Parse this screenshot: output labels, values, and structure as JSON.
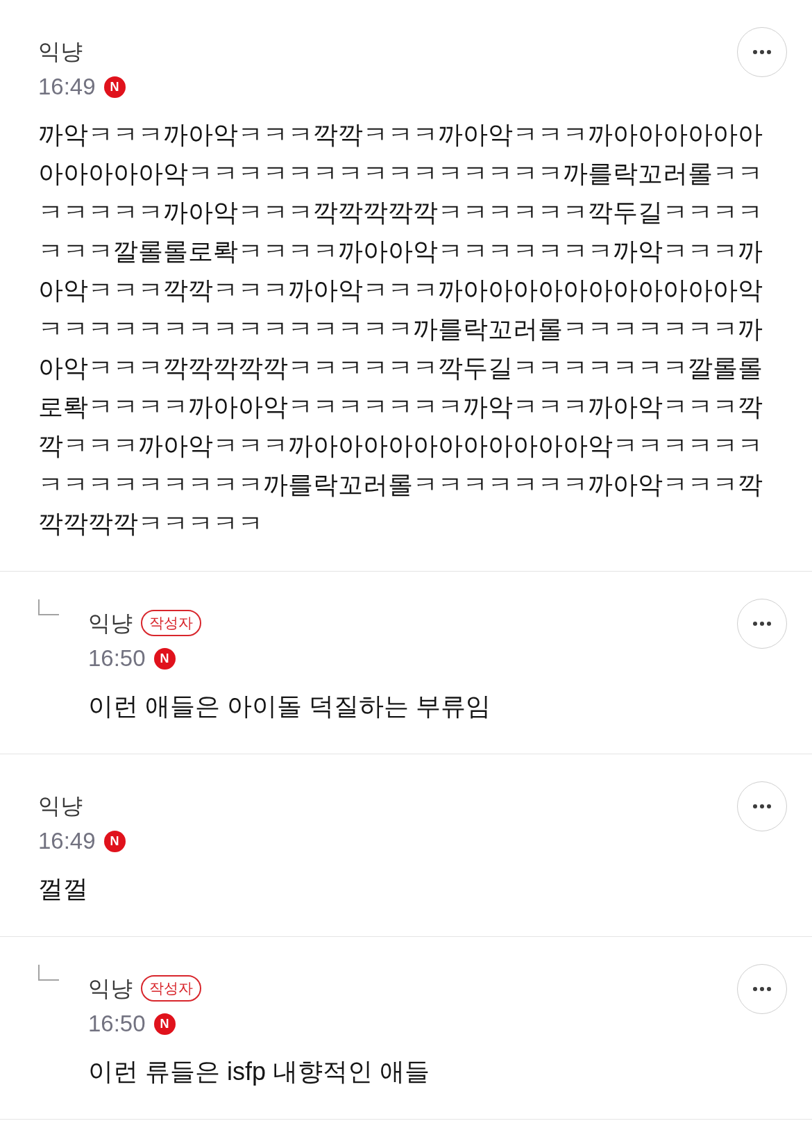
{
  "comments": [
    {
      "kind": "comment",
      "author": "익냥",
      "time": "16:49",
      "new_badge": "N",
      "body": "까악ㅋㅋㅋ까아악ㅋㅋㅋ깍깍ㅋㅋㅋ까아악ㅋㅋㅋ까아아아아아아아아아아아악ㅋㅋㅋㅋㅋㅋㅋㅋㅋㅋㅋㅋㅋㅋㅋ까를락꼬러롤ㅋㅋㅋㅋㅋㅋㅋ까아악ㅋㅋㅋ깍깍깍깍깍ㅋㅋㅋㅋㅋㅋ깍두길ㅋㅋㅋㅋㅋㅋㅋ깔롤롤로롹ㅋㅋㅋㅋ까아아악ㅋㅋㅋㅋㅋㅋㅋ까악ㅋㅋㅋ까아악ㅋㅋㅋ깍깍ㅋㅋㅋ까아악ㅋㅋㅋ까아아아아아아아아아아아악ㅋㅋㅋㅋㅋㅋㅋㅋㅋㅋㅋㅋㅋㅋㅋ까를락꼬러롤ㅋㅋㅋㅋㅋㅋㅋ까아악ㅋㅋㅋ깍깍깍깍깍ㅋㅋㅋㅋㅋㅋ깍두길ㅋㅋㅋㅋㅋㅋㅋ깔롤롤로롹ㅋㅋㅋㅋ까아아악ㅋㅋㅋㅋㅋㅋㅋ까악ㅋㅋㅋ까아악ㅋㅋㅋ깍깍ㅋㅋㅋ까아악ㅋㅋㅋ까아아아아아아아아아아아악ㅋㅋㅋㅋㅋㅋㅋㅋㅋㅋㅋㅋㅋㅋㅋ까를락꼬러롤ㅋㅋㅋㅋㅋㅋㅋ까아악ㅋㅋㅋ깍깍깍깍깍ㅋㅋㅋㅋㅋ"
    },
    {
      "kind": "reply",
      "author": "익냥",
      "author_badge": "작성자",
      "time": "16:50",
      "new_badge": "N",
      "body": "이런 애들은 아이돌 덕질하는 부류임"
    },
    {
      "kind": "comment",
      "author": "익냥",
      "time": "16:49",
      "new_badge": "N",
      "body": "껄껄"
    },
    {
      "kind": "reply",
      "author": "익냥",
      "author_badge": "작성자",
      "time": "16:50",
      "new_badge": "N",
      "body": "이런 류들은 isfp 내향적인 애들"
    }
  ]
}
